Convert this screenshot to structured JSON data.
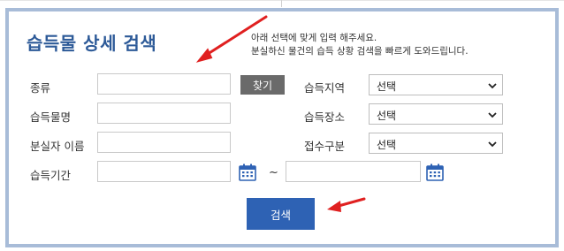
{
  "form": {
    "title": "습득물 상세 검색",
    "guide_line1": "아래 선택에 맞게 입력 해주세요.",
    "guide_line2": "분실하신 물건의 습득 상황 검색을 빠르게 도와드립니다.",
    "fields": {
      "category_label": "종류",
      "find_button": "찾기",
      "item_name_label": "습득물명",
      "owner_name_label": "분실자 이름",
      "period_label": "습득기간",
      "period_separator": "~",
      "region_label": "습득지역",
      "region_value": "선택",
      "place_label": "습득장소",
      "place_value": "선택",
      "reception_label": "접수구분",
      "reception_value": "선택"
    },
    "search_button": "검색"
  },
  "colors": {
    "title": "#2d5a98",
    "panel_border": "#a8bcd8",
    "search_button": "#2e62b4",
    "find_button": "#6a6a6a",
    "arrow": "#e02020",
    "calendar_icon": "#2e62b4"
  },
  "icons": {
    "calendar": "calendar-icon",
    "dropdown": "chevron-down-icon",
    "annotation": "arrow-icon"
  }
}
